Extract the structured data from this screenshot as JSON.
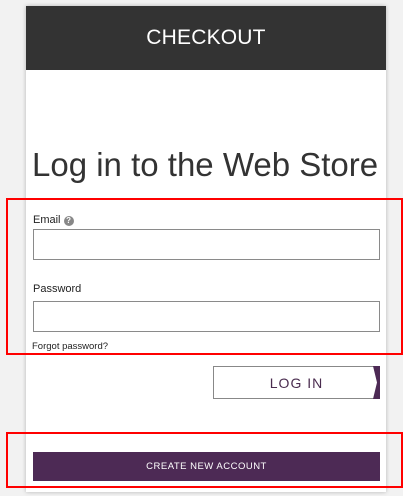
{
  "header": {
    "title": "CHECKOUT"
  },
  "page_title": "Log in to the Web Store",
  "form": {
    "email_label": "Email",
    "email_help_icon": "?",
    "email_value": "",
    "password_label": "Password",
    "password_value": "",
    "forgot_password": "Forgot password?"
  },
  "actions": {
    "login_label": "LOG IN",
    "create_account_label": "CREATE NEW ACCOUNT"
  },
  "colors": {
    "header_bg": "#333333",
    "accent": "#4d2a55",
    "highlight": "#ff0000"
  }
}
